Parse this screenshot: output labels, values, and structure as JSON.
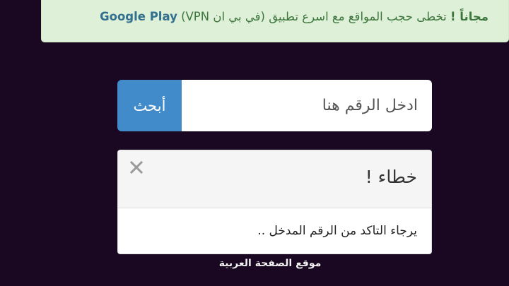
{
  "banner": {
    "free_label": "مجاناً !",
    "message": "تخطى حجب المواقع مع اسرع تطبيق (في بي ان VPN)",
    "link_text": "Google Play"
  },
  "search": {
    "placeholder": "ادخل الرقم هنا",
    "button_label": "أبحث"
  },
  "error": {
    "title": "خطاء !",
    "message": "يرجاء التاكد من الرقم المدخل ..",
    "close_icon": "close-icon"
  },
  "footer": {
    "credit": "موقع الصفحة العربية"
  },
  "colors": {
    "page_background": "#1a0722",
    "banner_background": "#dff0d8",
    "banner_text": "#3c763d",
    "link": "#31708f",
    "button": "#428bca"
  }
}
